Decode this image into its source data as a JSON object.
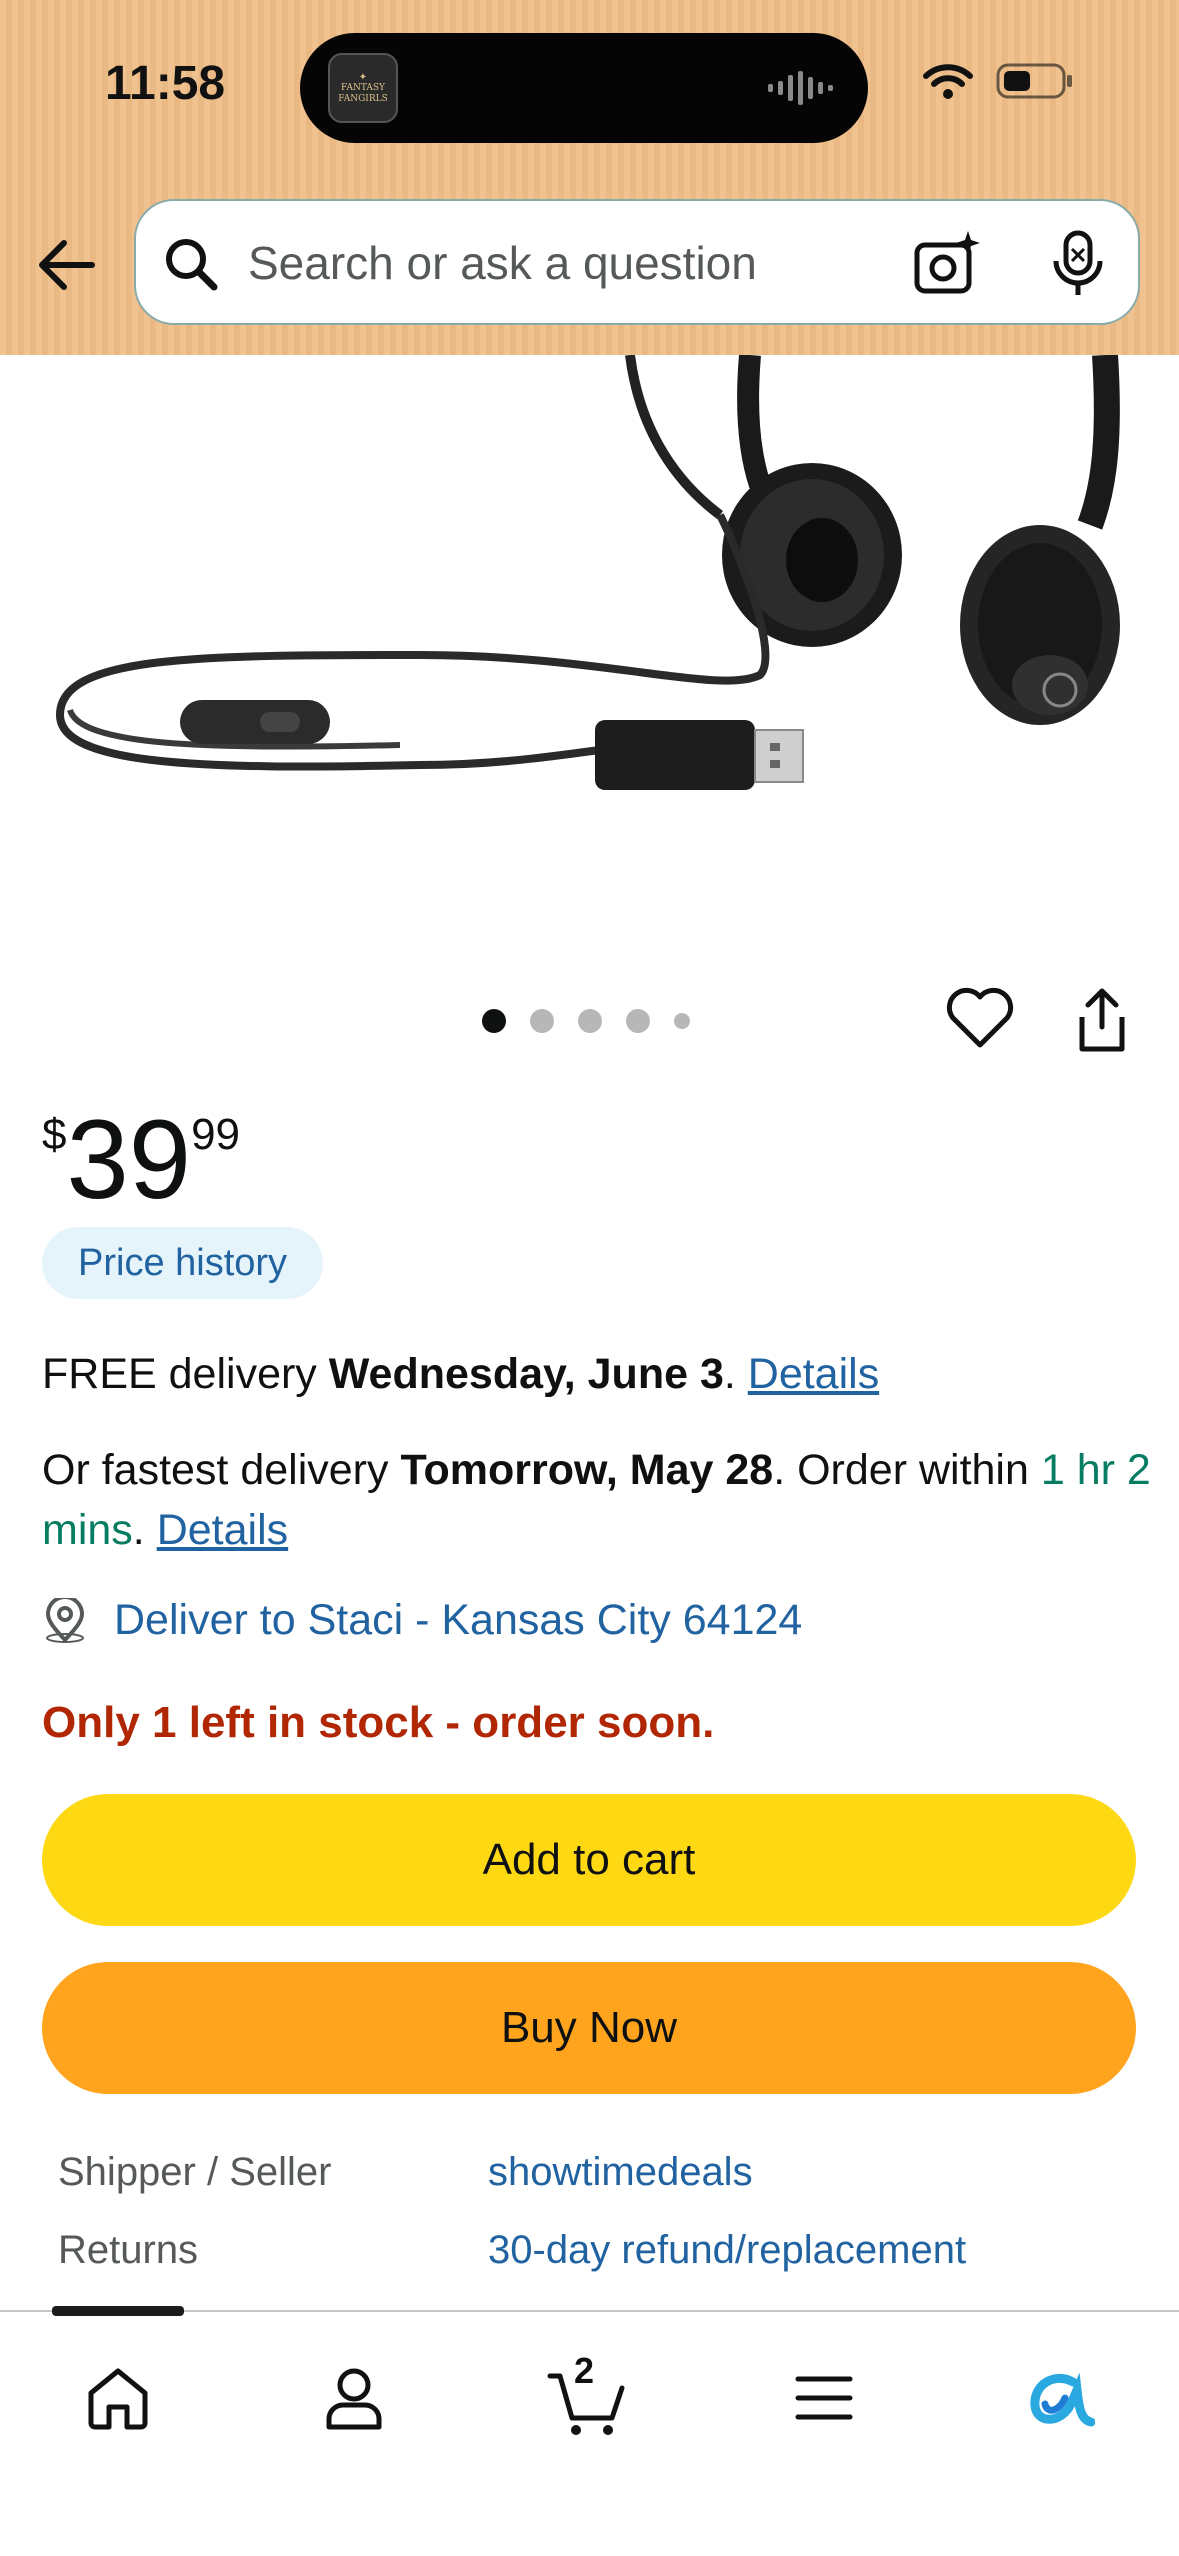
{
  "status": {
    "time": "11:58",
    "app_badge_text": "FANTASY FANGIRLS"
  },
  "search": {
    "placeholder": "Search or ask a question"
  },
  "carousel": {
    "total_images": 5,
    "active_index": 0
  },
  "price": {
    "symbol": "$",
    "whole": "39",
    "fraction": "99"
  },
  "price_history_label": "Price history",
  "delivery": {
    "free_prefix": "FREE delivery ",
    "free_date": "Wednesday, June 3",
    "free_sep": ". ",
    "details_label": "Details",
    "fast_prefix": "Or fastest delivery ",
    "fast_date": "Tomorrow, May 28",
    "fast_mid": ". Order within ",
    "fast_window": "1 hr 2 mins",
    "fast_sep": ". ",
    "deliver_to": "Deliver to Staci - Kansas City 64124"
  },
  "stock_message": "Only 1 left in stock - order soon.",
  "buttons": {
    "add_to_cart": "Add to cart",
    "buy_now": "Buy Now"
  },
  "details": [
    {
      "label": "Shipper / Seller",
      "value": "showtimedeals"
    },
    {
      "label": "Returns",
      "value": "30-day refund/replacement"
    }
  ],
  "nav": {
    "cart_count": "2"
  },
  "colors": {
    "header_bg": "#efbd86",
    "link": "#2162a1",
    "add_to_cart": "#ffd814",
    "buy_now": "#ffa41c",
    "stock_warning": "#b12704",
    "green_text": "#067d62"
  }
}
